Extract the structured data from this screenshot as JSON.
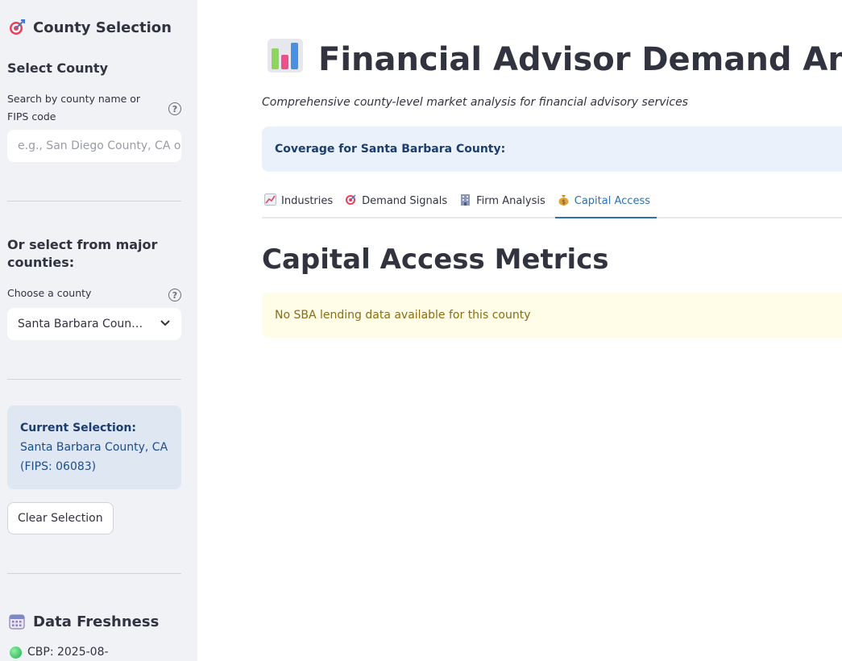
{
  "sidebar": {
    "heading": "County Selection",
    "heading_icon": "target-icon",
    "select_heading": "Select County",
    "search_label": "Search by county name or FIPS code",
    "search_placeholder": "e.g., San Diego County, CA or",
    "or_heading": "Or select from major counties:",
    "choose_label": "Choose a county",
    "select_value": "Santa Barbara Count…",
    "current_selection_label": "Current Selection:",
    "current_selection_value": "Santa Barbara County, CA (FIPS: 06083)",
    "clear_button": "Clear Selection",
    "freshness_heading": "Data Freshness",
    "freshness_item": "CBP: 2025-08-"
  },
  "main": {
    "title": "Financial Advisor Demand Analyze",
    "caption": "Comprehensive county-level market analysis for financial advisory services",
    "coverage": "Coverage for Santa Barbara County:",
    "tabs": [
      {
        "label": "Industries",
        "icon": "chart-icon",
        "active": false
      },
      {
        "label": "Demand Signals",
        "icon": "target-icon",
        "active": false
      },
      {
        "label": "Firm Analysis",
        "icon": "building-icon",
        "active": false
      },
      {
        "label": "Capital Access",
        "icon": "money-bag-icon",
        "active": true
      }
    ],
    "section_title": "Capital Access Metrics",
    "warning": "No SBA lending data available for this county"
  },
  "colors": {
    "sidebar_bg": "#f0f2f6",
    "accent": "#2f6fb3",
    "info_bg": "#dfe7f3",
    "warning_bg": "#fffce7",
    "warning_text": "#8a6d14"
  }
}
